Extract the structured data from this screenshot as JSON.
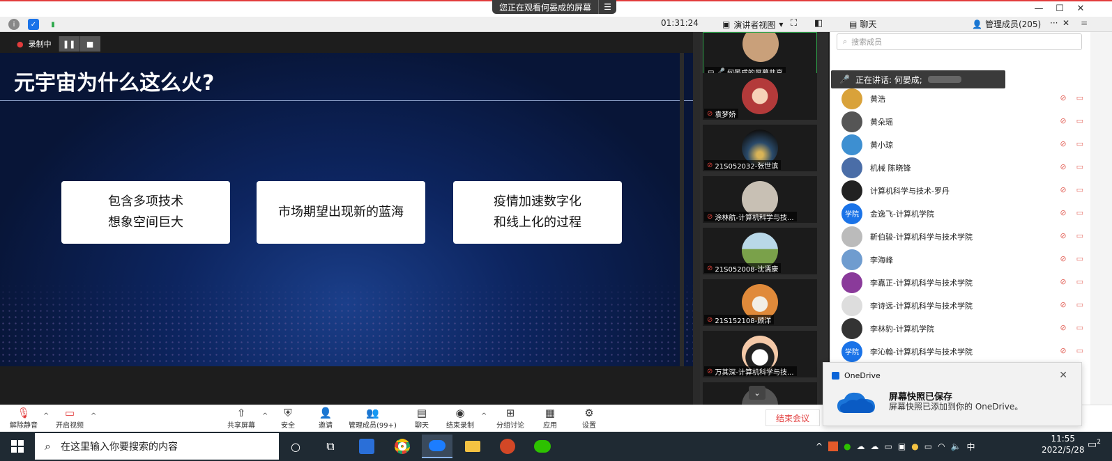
{
  "title_bar": {
    "share_banner": "您正在观看何晏成的屏幕",
    "window_controls": [
      "minimize-icon",
      "maximize-icon",
      "close-icon"
    ]
  },
  "toolbar": {
    "timer": "01:31:24",
    "view_mode": "演讲者视图",
    "chat_tab": "聊天",
    "members_tab": "管理成员(205)",
    "more": "···",
    "close": "✕"
  },
  "recording": {
    "label": "录制中"
  },
  "slide": {
    "title": "元宇宙为什么这么火?",
    "cards": [
      {
        "line1": "包含多项技术",
        "line2": "想象空间巨大"
      },
      {
        "line1": "市场期望出现新的蓝海",
        "line2": ""
      },
      {
        "line1": "疫情加速数字化",
        "line2": "和线上化的过程"
      }
    ]
  },
  "video_tiles": [
    {
      "name": "何晏成的屏幕共享",
      "color": "#c9a07a"
    },
    {
      "name": "袁梦娇",
      "color": "#b33a3a"
    },
    {
      "name": "21S052032-张世滨",
      "color": "#2a4a6a"
    },
    {
      "name": "涂林航-计算机科学与技...",
      "color": "#c8c0b4"
    },
    {
      "name": "21S052008-沈濡康",
      "color": "#7aa14a"
    },
    {
      "name": "21S152108-顾洋",
      "color": "#e08a3a"
    },
    {
      "name": "万其深-计算机科学与技...",
      "color": "#f0f0f0"
    }
  ],
  "members_panel": {
    "search_placeholder": "搜索成员",
    "speaking": "正在讲话: 何晏成;",
    "members": [
      {
        "name": "黄浩",
        "avatar_color": "#d9a23a",
        "avatar_text": ""
      },
      {
        "name": "黄朵瑶",
        "avatar_color": "#555555",
        "avatar_text": ""
      },
      {
        "name": "黄小琼",
        "avatar_color": "#3d8fd1",
        "avatar_text": ""
      },
      {
        "name": "机械 陈晓锋",
        "avatar_color": "#4a6da7",
        "avatar_text": ""
      },
      {
        "name": "计算机科学与技术-罗丹",
        "avatar_color": "#222222",
        "avatar_text": ""
      },
      {
        "name": "金逸飞-计算机学院",
        "avatar_color": "#1a73e8",
        "avatar_text": "学院"
      },
      {
        "name": "靳伯骏-计算机科学与技术学院",
        "avatar_color": "#bbbbbb",
        "avatar_text": ""
      },
      {
        "name": "李海峰",
        "avatar_color": "#6f9ccf",
        "avatar_text": ""
      },
      {
        "name": "李嘉正-计算机科学与技术学院",
        "avatar_color": "#8a3a9a",
        "avatar_text": ""
      },
      {
        "name": "李诗远-计算机科学与技术学院",
        "avatar_color": "#dddddd",
        "avatar_text": ""
      },
      {
        "name": "李林豹-计算机学院",
        "avatar_color": "#333333",
        "avatar_text": ""
      },
      {
        "name": "李沁翰-计算机科学与技术学院",
        "avatar_color": "#1a73e8",
        "avatar_text": "学院"
      }
    ]
  },
  "bottom_toolbar": {
    "buttons": [
      {
        "label": "解除静音",
        "icon": "mic-muted-icon"
      },
      {
        "label": "开启视频",
        "icon": "camera-off-icon"
      },
      {
        "label": "共享屏幕",
        "icon": "share-screen-icon"
      },
      {
        "label": "安全",
        "icon": "shield-icon"
      },
      {
        "label": "邀请",
        "icon": "invite-icon"
      },
      {
        "label": "管理成员(99+)",
        "icon": "participants-icon"
      },
      {
        "label": "聊天",
        "icon": "chat-icon"
      },
      {
        "label": "结束录制",
        "icon": "stop-record-icon"
      },
      {
        "label": "分组讨论",
        "icon": "breakout-icon"
      },
      {
        "label": "应用",
        "icon": "apps-icon"
      },
      {
        "label": "设置",
        "icon": "settings-icon"
      }
    ],
    "end_meeting": "结束会议"
  },
  "toast": {
    "app": "OneDrive",
    "title": "屏幕快照已保存",
    "body": "屏幕快照已添加到你的 OneDrive。"
  },
  "taskbar": {
    "search_placeholder": "在这里输入你要搜索的内容",
    "ime": "中",
    "time": "11:55",
    "date": "2022/5/28",
    "notifications": "2"
  }
}
